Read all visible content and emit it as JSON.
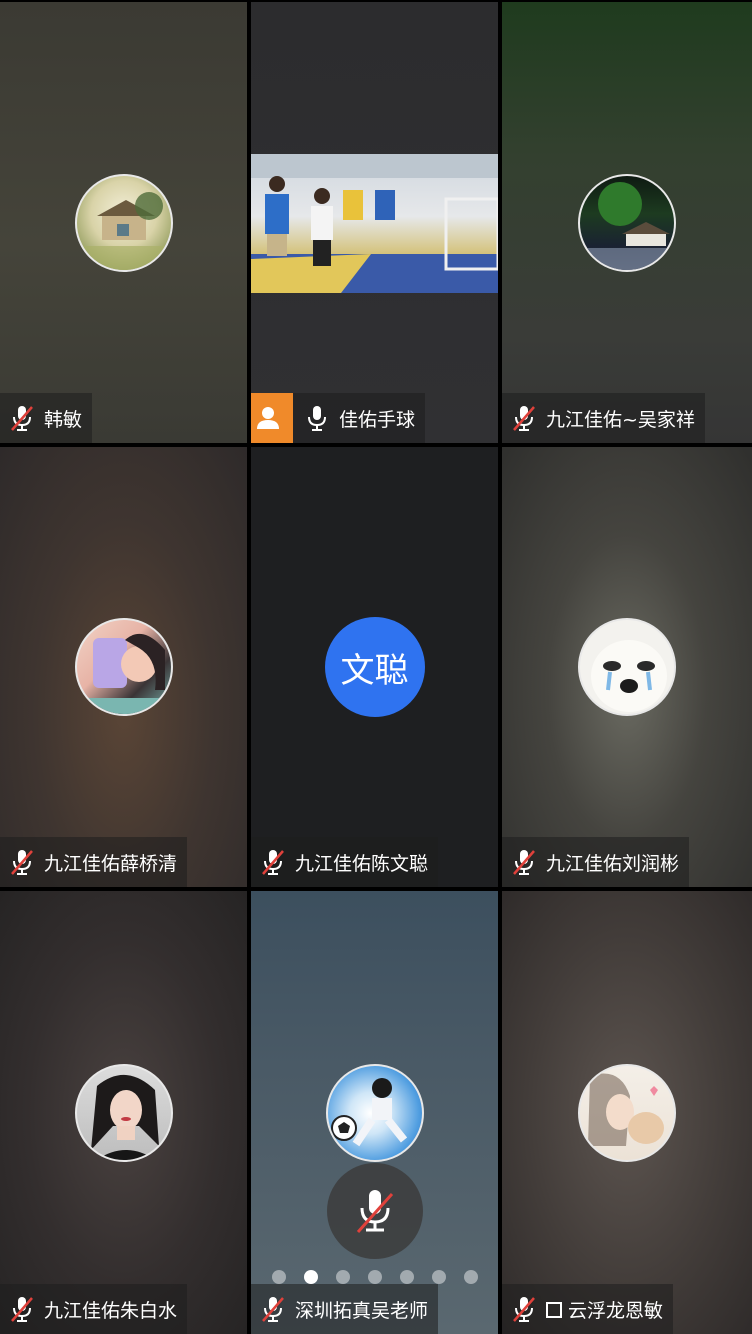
{
  "tiles": [
    {
      "name": "韩敏",
      "muted": true
    },
    {
      "name": "佳佑手球",
      "muted": false,
      "has_video": true
    },
    {
      "name": "九江佳佑~吴家祥",
      "muted": true
    },
    {
      "name": "九江佳佑薛桥清",
      "muted": true
    },
    {
      "name": "九江佳佑陈文聪",
      "muted": true,
      "avatar_text": "文聪",
      "avatar_color": "#2f73f0"
    },
    {
      "name": "九江佳佑刘润彬",
      "muted": true
    },
    {
      "name": "九江佳佑朱白水",
      "muted": true
    },
    {
      "name": "深圳拓真吴老师",
      "muted": true
    },
    {
      "name": "云浮龙恩敏",
      "muted": true
    }
  ],
  "pager": {
    "count": 7,
    "active_index": 1
  },
  "colors": {
    "muted_red": "#e0413b",
    "accent_orange": "#f08a2a",
    "avatar_blue": "#2f73f0"
  }
}
